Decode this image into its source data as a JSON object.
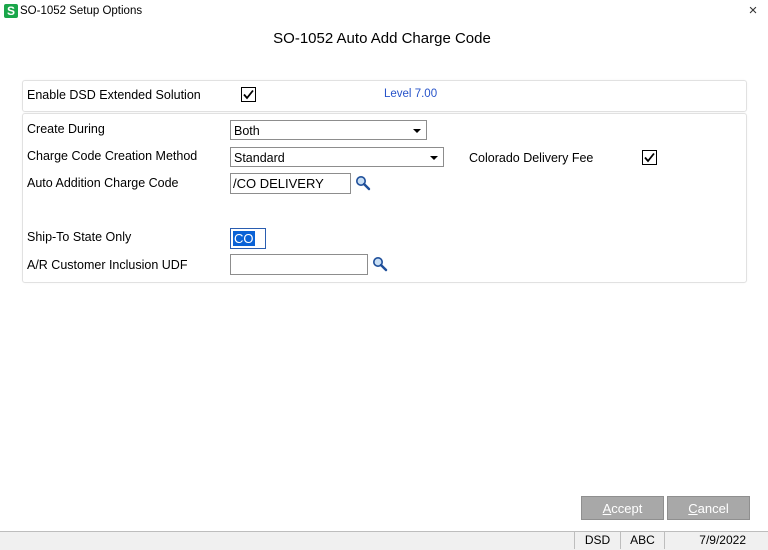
{
  "window": {
    "app_icon_letter": "S",
    "title": "SO-1052 Setup Options",
    "close_glyph": "×"
  },
  "heading": "SO-1052 Auto Add Charge Code",
  "enable_section": {
    "label": "Enable DSD Extended Solution",
    "checked": true,
    "level_label": "Level",
    "level_value": "7.00"
  },
  "form": {
    "create_during": {
      "label": "Create During",
      "value": "Both"
    },
    "creation_method": {
      "label": "Charge Code Creation Method",
      "value": "Standard"
    },
    "colorado_fee": {
      "label": "Colorado Delivery Fee",
      "checked": true
    },
    "auto_addition": {
      "label": "Auto Addition Charge Code",
      "value": "/CO DELIVERY",
      "lookup_icon": "magnifier-icon"
    },
    "ship_to_state": {
      "label": "Ship-To State Only",
      "value": "CO"
    },
    "ar_customer_udf": {
      "label": "A/R Customer Inclusion UDF",
      "value": "",
      "lookup_icon": "magnifier-icon"
    }
  },
  "buttons": {
    "accept_first": "A",
    "accept_rest": "ccept",
    "cancel_first": "C",
    "cancel_rest": "ancel"
  },
  "status_bar": {
    "module": "DSD",
    "company": "ABC",
    "date": "7/9/2022"
  },
  "colors": {
    "accent": "#1aa64a",
    "level_text": "#2753c9",
    "selection": "#0a62d6",
    "button_bg": "#a8a8a8"
  }
}
